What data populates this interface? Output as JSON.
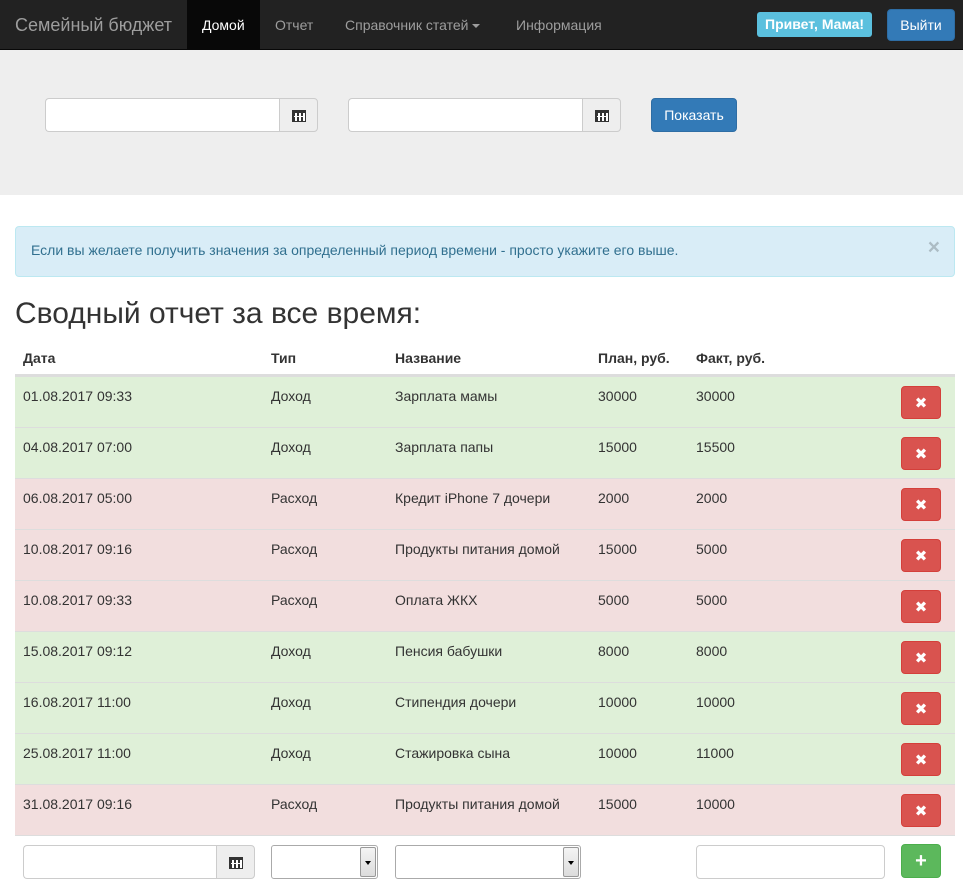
{
  "navbar": {
    "brand": "Семейный бюджет",
    "items": [
      {
        "label": "Домой",
        "active": true
      },
      {
        "label": "Отчет",
        "active": false
      },
      {
        "label": "Справочник статей",
        "active": false,
        "dropdown": true
      },
      {
        "label": "Информация",
        "active": false
      }
    ],
    "greeting": "Привет, Мама!",
    "logout_label": "Выйти"
  },
  "filter": {
    "date_from_value": "",
    "date_to_value": "",
    "calendar_icon": "calendar-icon",
    "show_label": "Показать"
  },
  "alert": {
    "text": "Если вы желаете получить значения за определенный период времени - просто укажите его выше.",
    "close_symbol": "×"
  },
  "report": {
    "title": "Сводный отчет за все время:",
    "columns": [
      "Дата",
      "Тип",
      "Название",
      "План, руб.",
      "Факт, руб."
    ],
    "rows": [
      {
        "date": "01.08.2017 09:33",
        "type": "Доход",
        "name": "Зарплата мамы",
        "plan": "30000",
        "fact": "30000",
        "kind": "income"
      },
      {
        "date": "04.08.2017 07:00",
        "type": "Доход",
        "name": "Зарплата папы",
        "plan": "15000",
        "fact": "15500",
        "kind": "income"
      },
      {
        "date": "06.08.2017 05:00",
        "type": "Расход",
        "name": "Кредит iPhone 7 дочери",
        "plan": "2000",
        "fact": "2000",
        "kind": "expense"
      },
      {
        "date": "10.08.2017 09:16",
        "type": "Расход",
        "name": "Продукты питания домой",
        "plan": "15000",
        "fact": "5000",
        "kind": "expense"
      },
      {
        "date": "10.08.2017 09:33",
        "type": "Расход",
        "name": "Оплата ЖКХ",
        "plan": "5000",
        "fact": "5000",
        "kind": "expense"
      },
      {
        "date": "15.08.2017 09:12",
        "type": "Доход",
        "name": "Пенсия бабушки",
        "plan": "8000",
        "fact": "8000",
        "kind": "income"
      },
      {
        "date": "16.08.2017 11:00",
        "type": "Доход",
        "name": "Стипендия дочери",
        "plan": "10000",
        "fact": "10000",
        "kind": "income"
      },
      {
        "date": "25.08.2017 11:00",
        "type": "Доход",
        "name": "Стажировка сына",
        "plan": "10000",
        "fact": "11000",
        "kind": "income"
      },
      {
        "date": "31.08.2017 09:16",
        "type": "Расход",
        "name": "Продукты питания домой",
        "plan": "15000",
        "fact": "10000",
        "kind": "expense"
      }
    ],
    "delete_symbol": "✖",
    "add_symbol": "+",
    "colors": {
      "income": "#dff0d8",
      "expense": "#f2dede",
      "danger": "#d9534f",
      "success": "#5cb85c",
      "primary": "#337ab7",
      "info": "#5bc0de"
    }
  }
}
